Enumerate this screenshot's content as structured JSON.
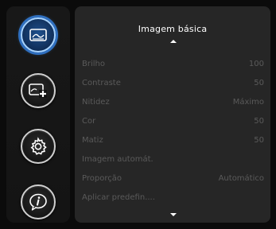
{
  "sidebar": {
    "buttons": [
      {
        "icon": "picture-icon",
        "active": true
      },
      {
        "icon": "add-picture-icon",
        "active": false
      },
      {
        "icon": "gear-icon",
        "active": false
      },
      {
        "icon": "info-icon",
        "active": false
      }
    ]
  },
  "panel": {
    "title": "Imagem básica",
    "rows": [
      {
        "label": "Brilho",
        "value": "100"
      },
      {
        "label": "Contraste",
        "value": "50"
      },
      {
        "label": "Nitidez",
        "value": "Máximo"
      },
      {
        "label": "Cor",
        "value": "50"
      },
      {
        "label": "Matiz",
        "value": "50"
      },
      {
        "label": "Imagem automát.",
        "value": ""
      },
      {
        "label": "Proporção",
        "value": "Automático"
      },
      {
        "label": "Aplicar predefin....",
        "value": ""
      }
    ]
  },
  "colors": {
    "accent": "#2f6fbf",
    "panel_bg": "#262626",
    "disabled_text": "#5a5a5a"
  }
}
